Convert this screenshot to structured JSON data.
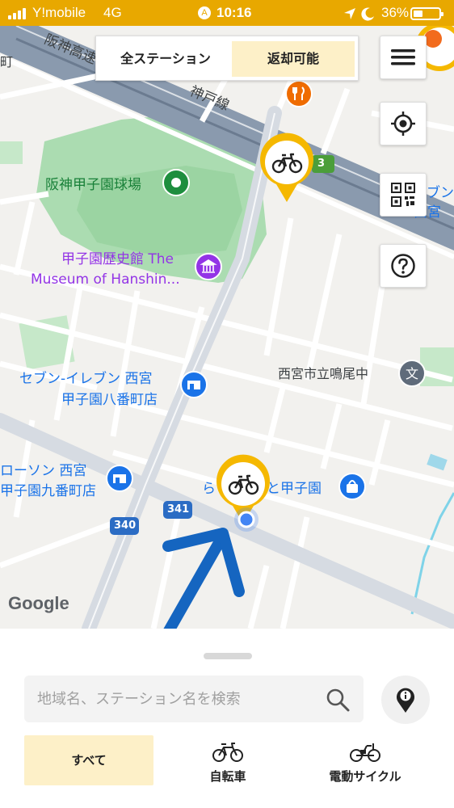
{
  "status_bar": {
    "carrier": "Y!mobile",
    "network": "4G",
    "time": "10:16",
    "battery": "36%"
  },
  "filter_tabs": {
    "all_stations": "全ステーション",
    "returnable": "返却可能"
  },
  "map": {
    "labels": {
      "expressway": "阪神高速",
      "line_name": "神戸線",
      "town_left": "町",
      "stadium": "阪神甲子園球場",
      "museum_line1": "甲子園歴史館 The",
      "museum_line2": "Museum of Hanshin...",
      "seven_line1": "セブン-イレブン 西宮",
      "seven_line2": "甲子園八番町店",
      "lawson_line1": "ローソン 西宮",
      "lawson_line2": "甲子園九番町店",
      "school": "西宮市立鳴尾中",
      "lalaport_a": "ら",
      "lalaport_b": "と甲子園",
      "seven_right_line1": "ブン",
      "seven_right_line2": "西宮",
      "route_3": "3",
      "route_341": "341",
      "route_340": "340",
      "google": "Google"
    }
  },
  "side_buttons": [
    "menu-icon",
    "locate-icon",
    "qr-code-icon",
    "help-icon"
  ],
  "search": {
    "placeholder": "地域名、ステーション名を検索"
  },
  "categories": {
    "all": "すべて",
    "bicycle": "自転車",
    "ebike": "電動サイクル"
  },
  "colors": {
    "accent_yellow": "#f5b800",
    "selected_tab": "#fdf0c8",
    "status_bar": "#e8a800",
    "arrow_blue": "#1565c0",
    "poi_blue": "#1a73e8"
  }
}
